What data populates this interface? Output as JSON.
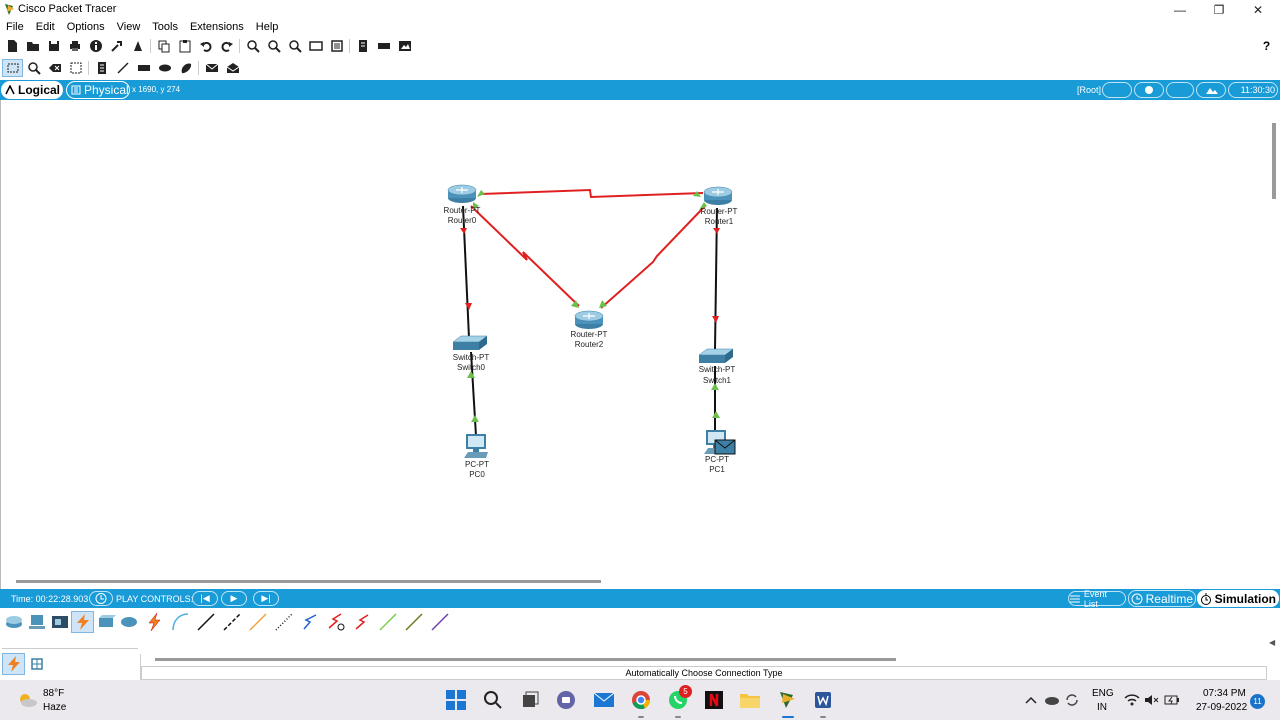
{
  "window": {
    "title": "Cisco Packet Tracer",
    "minimize": "—",
    "maximize": "❐",
    "close": "✕"
  },
  "menu": [
    "File",
    "Edit",
    "Options",
    "View",
    "Tools",
    "Extensions",
    "Help"
  ],
  "toolbar": {
    "help": "?"
  },
  "viewbar": {
    "logical": "Logical",
    "physical": "Physical",
    "coords": "x 1690, y 274",
    "root": "[Root]",
    "clock": "11:30:30"
  },
  "devices": [
    {
      "type": "router",
      "model": "Router-PT",
      "name": "Router0"
    },
    {
      "type": "router",
      "model": "Router-PT",
      "name": "Router1"
    },
    {
      "type": "router",
      "model": "Router-PT",
      "name": "Router2"
    },
    {
      "type": "switch",
      "model": "Switch-PT",
      "name": "Switch0"
    },
    {
      "type": "switch",
      "model": "Switch-PT",
      "name": "Switch1"
    },
    {
      "type": "pc",
      "model": "PC-PT",
      "name": "PC0"
    },
    {
      "type": "pc",
      "model": "PC-PT",
      "name": "PC1"
    }
  ],
  "colors": {
    "accent_blue": "#189bd7",
    "serial_link": "#e02020",
    "ethernet_link": "#111111",
    "port_up": "#6ac04a",
    "port_down": "#e02020"
  },
  "simbar": {
    "time": "Time: 00:22:28.903",
    "play_controls": "PLAY CONTROLS:",
    "back": "|◀",
    "play": "▶",
    "forward": "▶|",
    "event_list": "Event List",
    "realtime": "Realtime",
    "simulation": "Simulation"
  },
  "panel": {
    "connection_description": "Automatically Choose Connection Type",
    "scroll_arrow": "◀"
  },
  "taskbar": {
    "temperature": "88°F",
    "weather": "Haze",
    "whatsapp_badge": "5",
    "lang1": "ENG",
    "lang2": "IN",
    "time": "07:34 PM",
    "date": "27-09-2022",
    "notifications": "11"
  }
}
